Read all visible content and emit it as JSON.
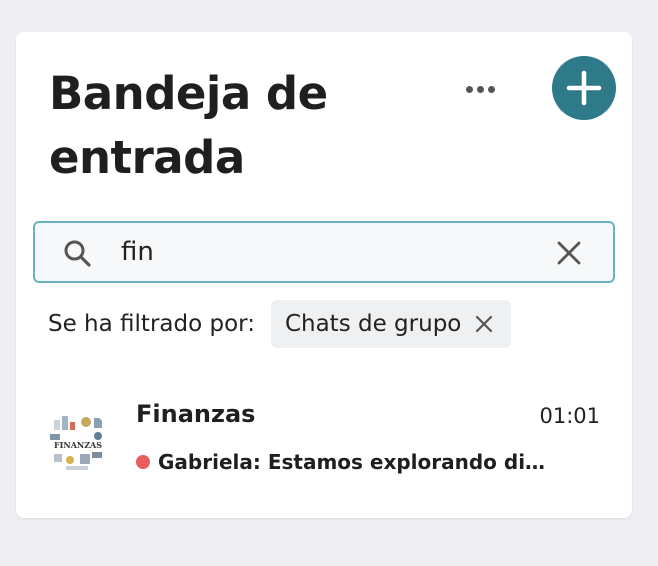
{
  "header": {
    "title": "Bandeja de entrada",
    "more_icon": "more-horizontal-icon",
    "compose_icon": "plus-icon"
  },
  "search": {
    "value": "fin",
    "placeholder": "",
    "search_icon": "search-icon",
    "clear_icon": "close-icon"
  },
  "filter": {
    "label": "Se ha filtrado por:",
    "chip_label": "Chats de grupo",
    "chip_remove_icon": "close-icon"
  },
  "chats": [
    {
      "name": "Finanzas",
      "time": "01:01",
      "preview": "Gabriela: Estamos explorando di…",
      "avatar_text": "FINANZAS",
      "unread": true
    }
  ],
  "colors": {
    "accent": "#2f7a89",
    "search_border": "#6ab0c6",
    "unread_dot": "#e85d5d",
    "background": "#efeef3"
  }
}
